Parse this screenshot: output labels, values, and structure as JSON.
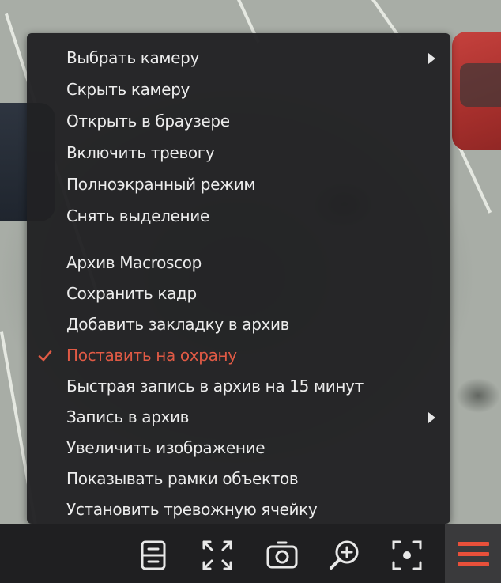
{
  "context_menu": {
    "items": [
      {
        "label": "Выбрать камеру",
        "has_submenu": true,
        "checked": false
      },
      {
        "label": "Скрыть камеру",
        "has_submenu": false,
        "checked": false
      },
      {
        "label": "Открыть в браузере",
        "has_submenu": false,
        "checked": false
      },
      {
        "label": "Включить тревогу",
        "has_submenu": false,
        "checked": false
      },
      {
        "label": "Полноэкранный режим",
        "has_submenu": false,
        "checked": false
      },
      {
        "label": "Снять выделение",
        "has_submenu": false,
        "checked": false
      },
      {
        "label": "Архив Macroscop",
        "has_submenu": false,
        "checked": false
      },
      {
        "label": "Сохранить кадр",
        "has_submenu": false,
        "checked": false
      },
      {
        "label": "Добавить закладку в архив",
        "has_submenu": false,
        "checked": false
      },
      {
        "label": "Поставить на охрану",
        "has_submenu": false,
        "checked": true
      },
      {
        "label": "Быстрая запись в архив на 15 минут",
        "has_submenu": false,
        "checked": false
      },
      {
        "label": "Запись в архив",
        "has_submenu": true,
        "checked": false
      },
      {
        "label": "Увеличить изображение",
        "has_submenu": false,
        "checked": false
      },
      {
        "label": "Показывать рамки объектов",
        "has_submenu": false,
        "checked": false
      },
      {
        "label": "Установить тревожную ячейку",
        "has_submenu": false,
        "checked": false
      }
    ]
  },
  "toolbar": {
    "buttons": [
      {
        "name": "archive-button",
        "icon": "archive-panel-icon"
      },
      {
        "name": "fullscreen-button",
        "icon": "fullscreen-arrows-icon"
      },
      {
        "name": "snapshot-button",
        "icon": "camera-icon"
      },
      {
        "name": "zoom-in-button",
        "icon": "zoom-in-icon"
      },
      {
        "name": "focus-button",
        "icon": "focus-frame-icon"
      },
      {
        "name": "menu-button",
        "icon": "hamburger-menu-icon"
      }
    ]
  },
  "colors": {
    "menu_background": "#212123",
    "menu_text": "#ececec",
    "checked_accent": "#e05a45",
    "toolbar_background": "#1f1f21",
    "toolbar_icon": "#e8e8e8",
    "menu_button_icon": "#e8503a"
  }
}
